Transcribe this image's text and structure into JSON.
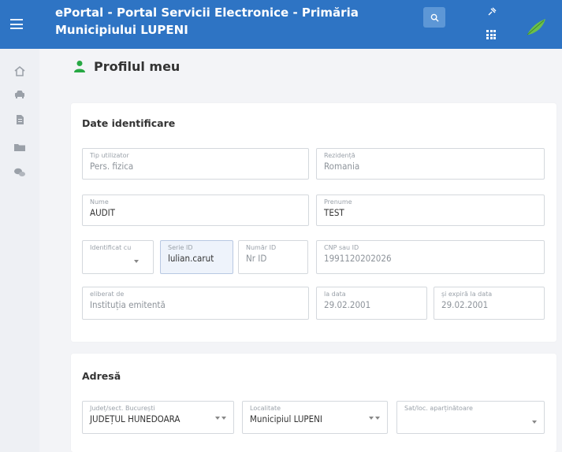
{
  "header": {
    "title": "ePortal - Portal Servicii Electronice - Primăria Municipiului LUPENI",
    "accent_color": "#2e74c4",
    "icons": [
      "menu-icon",
      "search-icon",
      "pin-icon",
      "apps-grid-icon",
      "leaf-logo-icon"
    ]
  },
  "rail": {
    "icons": [
      "home-icon",
      "car-icon",
      "document-icon",
      "folder-icon",
      "chat-icon"
    ]
  },
  "page": {
    "title": "Profilul meu"
  },
  "identification": {
    "section_title": "Date identificare",
    "tip_utilizator": {
      "label": "Tip utilizator",
      "value": "Pers. fizica"
    },
    "rezidenta": {
      "label": "Rezidență",
      "value": "Romania"
    },
    "nume": {
      "label": "Nume",
      "value": "AUDIT"
    },
    "prenume": {
      "label": "Prenume",
      "value": "TEST"
    },
    "identificat_cu": {
      "label": "Identificat cu",
      "value": ""
    },
    "serie_id": {
      "label": "Serie ID",
      "value": "lulian.carut"
    },
    "numar_id": {
      "label": "Număr ID",
      "value": "Nr ID"
    },
    "cnp": {
      "label": "CNP sau ID",
      "value": "1991120202026"
    },
    "eliberat_de": {
      "label": "eliberat de",
      "value": "Instituția emitentă"
    },
    "la_data": {
      "label": "la data",
      "value": "29.02.2001"
    },
    "expira_la": {
      "label": "și expiră la data",
      "value": "29.02.2001"
    }
  },
  "address": {
    "section_title": "Adresă",
    "judet": {
      "label": "Județ/sect. București",
      "value": "JUDEȚUL HUNEDOARA"
    },
    "localitate": {
      "label": "Localitate",
      "value": "Municipiul LUPENI"
    },
    "sat": {
      "label": "Sat/loc. aparținătoare",
      "value": ""
    }
  }
}
